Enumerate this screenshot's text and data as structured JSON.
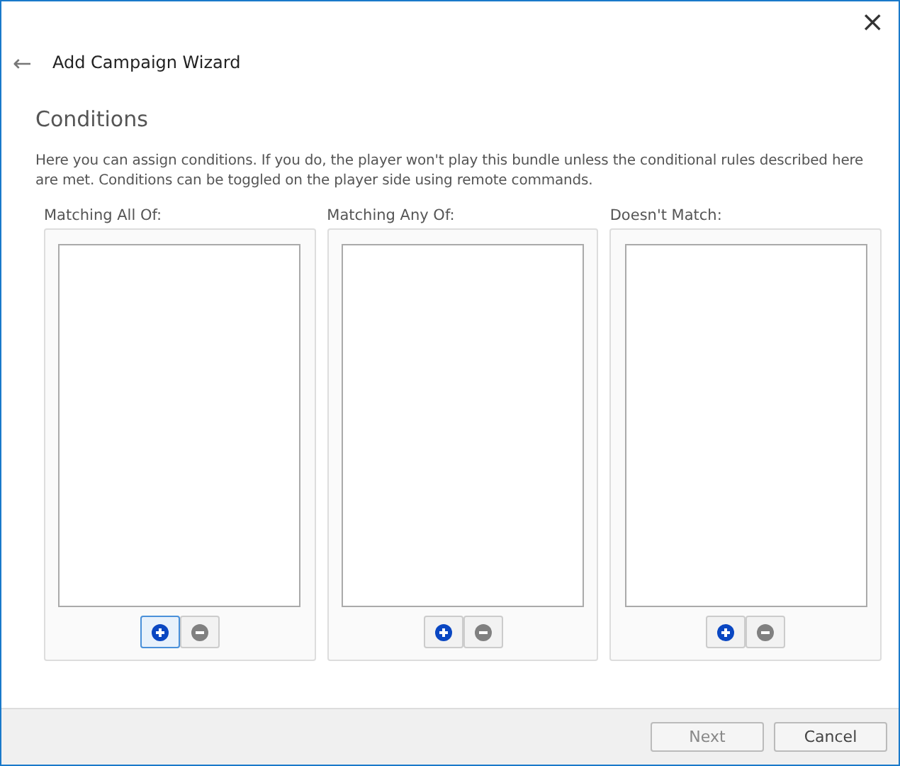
{
  "window": {
    "title": "Add Campaign Wizard",
    "close": "×",
    "back": "←"
  },
  "heading": "Conditions",
  "description": "Here you can assign conditions. If you do, the player won't play this bundle unless the conditional rules described here are met. Conditions can be toggled on the player side using remote commands.",
  "panels": [
    {
      "label": "Matching All Of:",
      "add_focused": true
    },
    {
      "label": "Matching Any Of:",
      "add_focused": false
    },
    {
      "label": "Doesn't Match:",
      "add_focused": false
    }
  ],
  "buttons": [
    {
      "label": "Next",
      "disabled": true
    },
    {
      "label": "Cancel",
      "disabled": false
    }
  ]
}
